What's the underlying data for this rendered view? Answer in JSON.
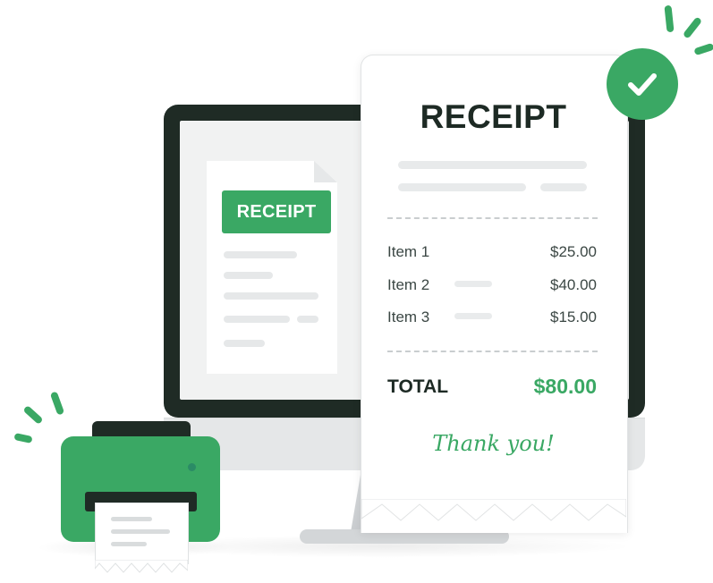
{
  "screen_document": {
    "badge_text": "RECEIPT"
  },
  "receipt": {
    "title": "RECEIPT",
    "items": [
      {
        "label": "Item 1",
        "price": "$25.00"
      },
      {
        "label": "Item 2",
        "price": "$40.00"
      },
      {
        "label": "Item 3",
        "price": "$15.00"
      }
    ],
    "total_label": "TOTAL",
    "total_value": "$80.00",
    "footer": "Thank you!"
  },
  "icons": {
    "status": "checkmark-icon",
    "device": "printer-icon"
  },
  "colors": {
    "accent": "#3aa864",
    "dark": "#1f2b25",
    "text": "#3b4744"
  }
}
